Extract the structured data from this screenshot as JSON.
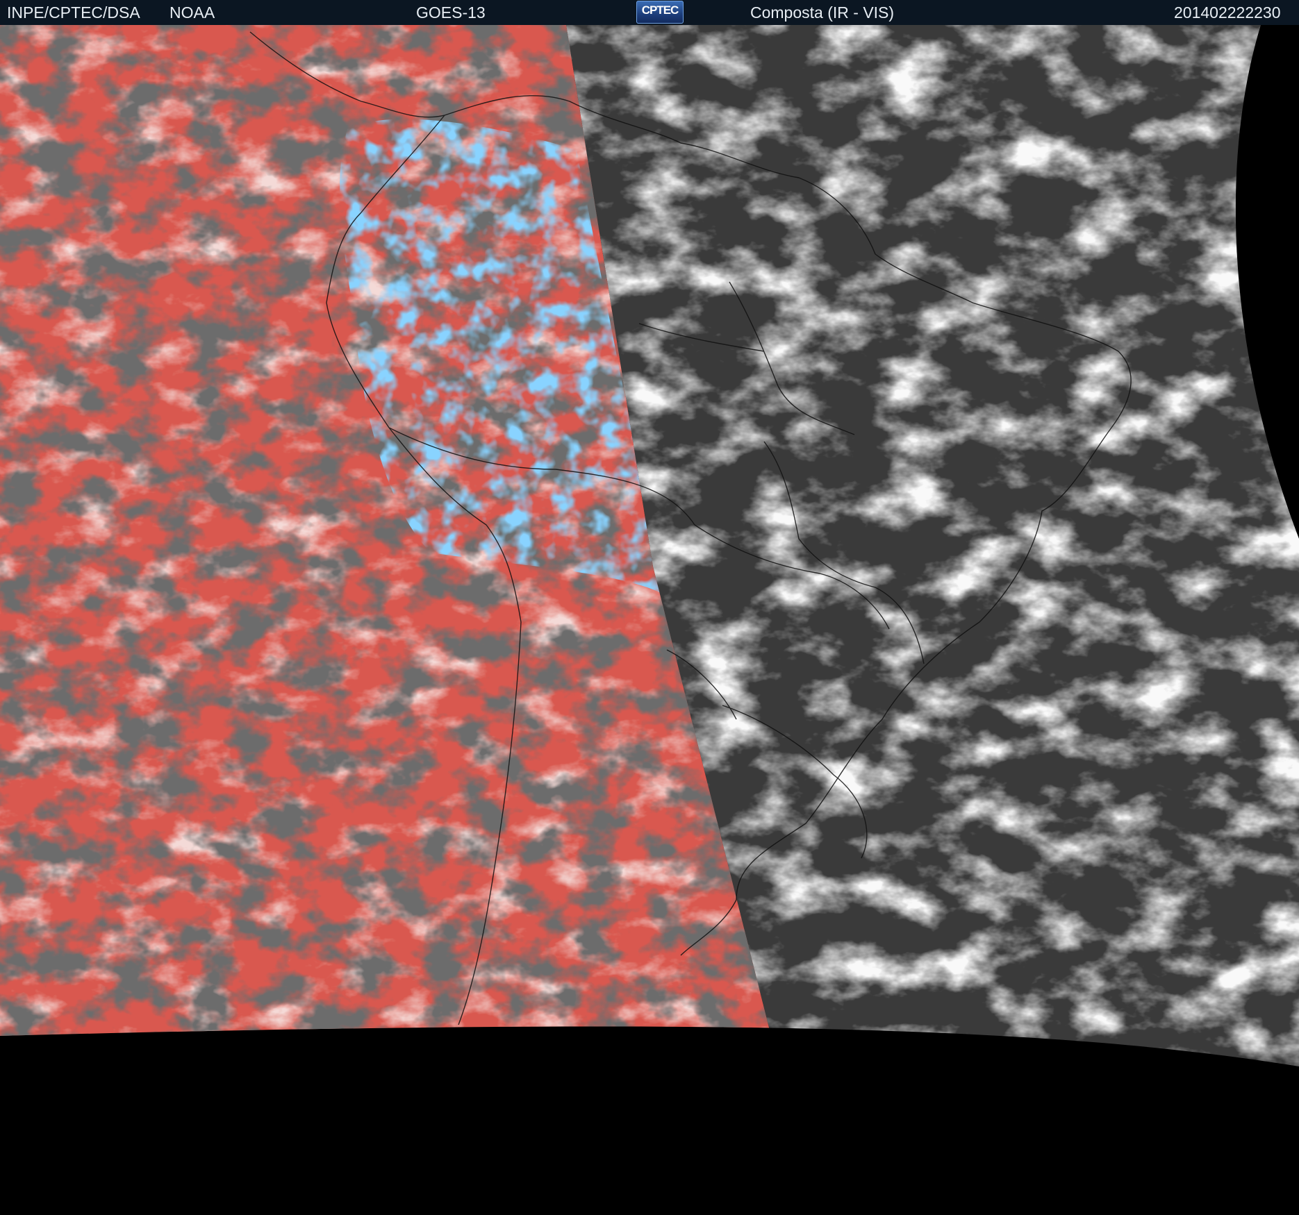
{
  "header": {
    "source": "INPE/CPTEC/DSA",
    "agency": "NOAA",
    "satellite": "GOES-13",
    "logo_text": "CPTEC",
    "product": "Composta (IR - VIS)",
    "timestamp": "201402222230"
  },
  "colors": {
    "header_bg": "#0b1622",
    "ir_warm": "#d9584f",
    "ir_cold": "#3aa0f0",
    "vis_dark": "#3a3a3a",
    "vis_cloud": "#d8d8d8",
    "space": "#000000"
  }
}
